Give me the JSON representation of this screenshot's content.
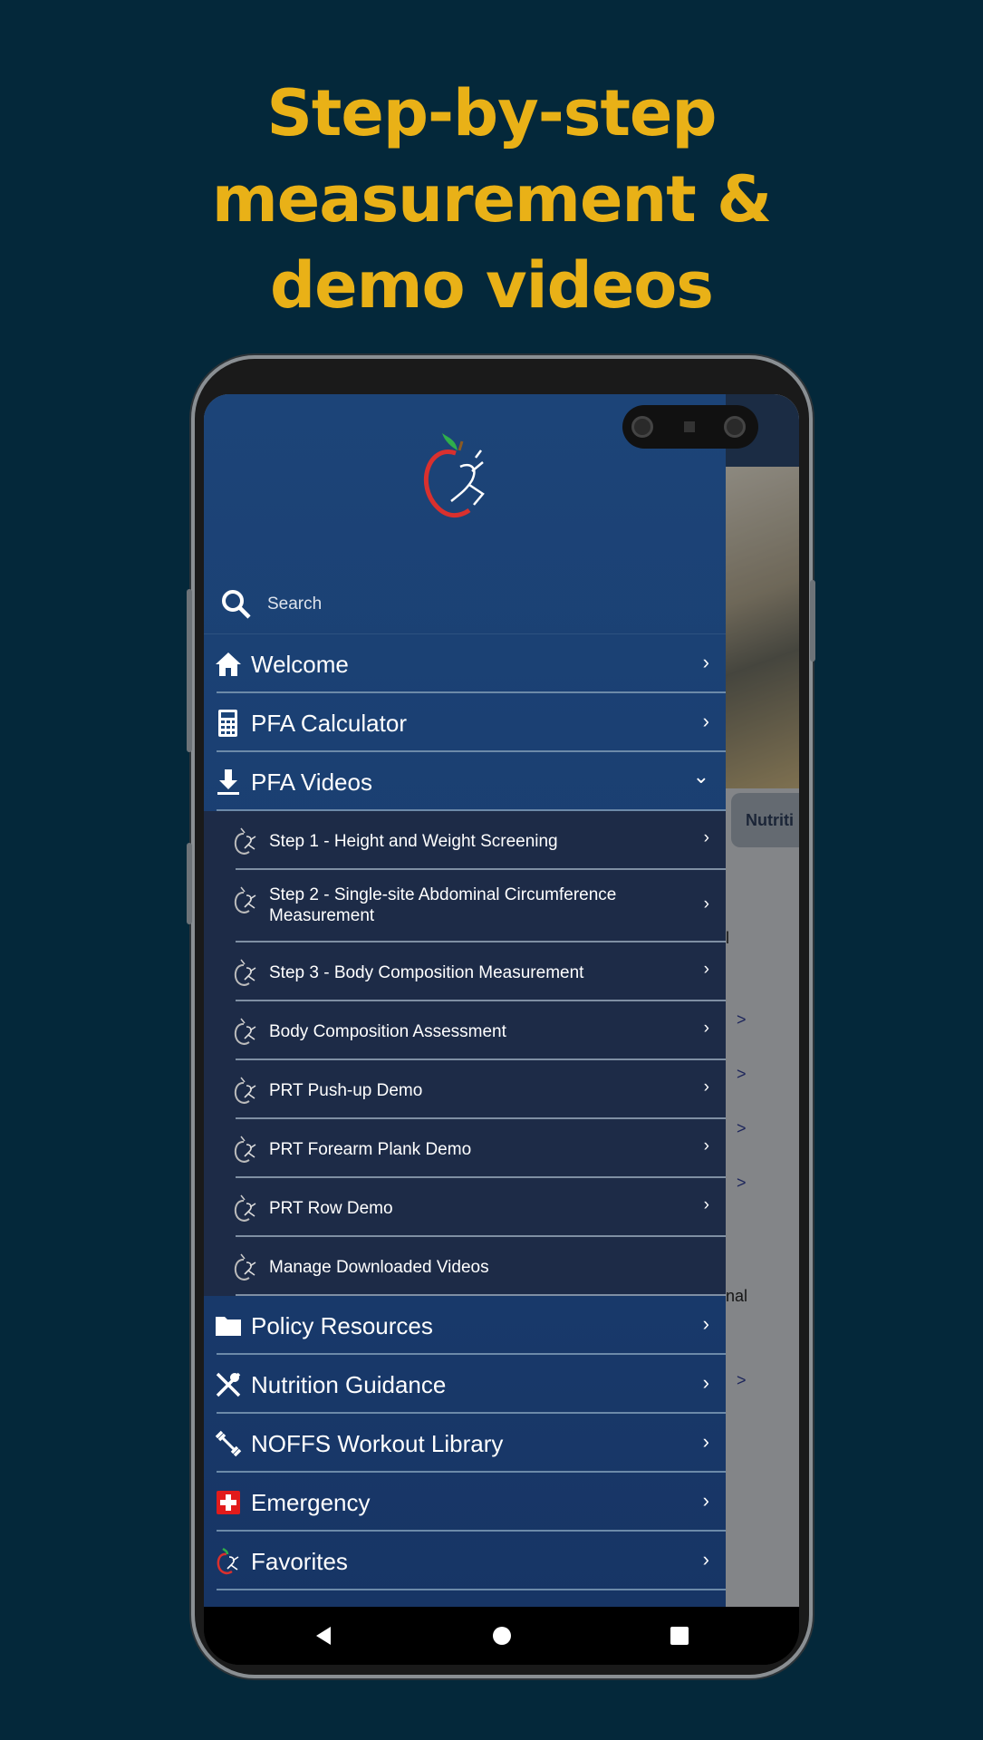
{
  "headline": {
    "line1": "Step-by-step",
    "line2": "measurement &",
    "line3": "demo videos"
  },
  "colors": {
    "headline": "#e9b117",
    "background": "#04283a",
    "drawer": "#1c4478",
    "submenu": "#1d2b47"
  },
  "search": {
    "placeholder": "Search",
    "icon": "search-icon"
  },
  "menu": [
    {
      "label": "Welcome",
      "icon": "home-icon",
      "chevron": "›"
    },
    {
      "label": "PFA Calculator",
      "icon": "calculator-icon",
      "chevron": "›"
    },
    {
      "label": "PFA Videos",
      "icon": "download-icon",
      "chevron": "⌄",
      "expanded": true
    }
  ],
  "submenu": [
    {
      "label": "Step 1 - Height and Weight Screening",
      "chevron": "›"
    },
    {
      "label": "Step 2 - Single-site Abdominal Circumference Measurement",
      "chevron": "›"
    },
    {
      "label": "Step 3 - Body Composition Measurement",
      "chevron": "›"
    },
    {
      "label": "Body Composition Assessment",
      "chevron": "›"
    },
    {
      "label": "PRT Push-up Demo",
      "chevron": "›"
    },
    {
      "label": "PRT Forearm Plank Demo",
      "chevron": "›"
    },
    {
      "label": "PRT Row Demo",
      "chevron": "›"
    },
    {
      "label": "Manage Downloaded Videos",
      "chevron": ""
    }
  ],
  "menu2": [
    {
      "label": "Policy Resources",
      "icon": "folder-icon",
      "chevron": "›"
    },
    {
      "label": "Nutrition Guidance",
      "icon": "utensils-icon",
      "chevron": "›"
    },
    {
      "label": "NOFFS Workout Library",
      "icon": "dumbbell-icon",
      "chevron": "›"
    },
    {
      "label": "Emergency",
      "icon": "medical-cross-icon",
      "chevron": "›"
    },
    {
      "label": "Favorites",
      "icon": "apple-logo-icon",
      "chevron": "›"
    }
  ],
  "background_content": {
    "tab": "Nutriti",
    "frag1": "l",
    "frag2": "nal",
    "chevron": ">"
  }
}
